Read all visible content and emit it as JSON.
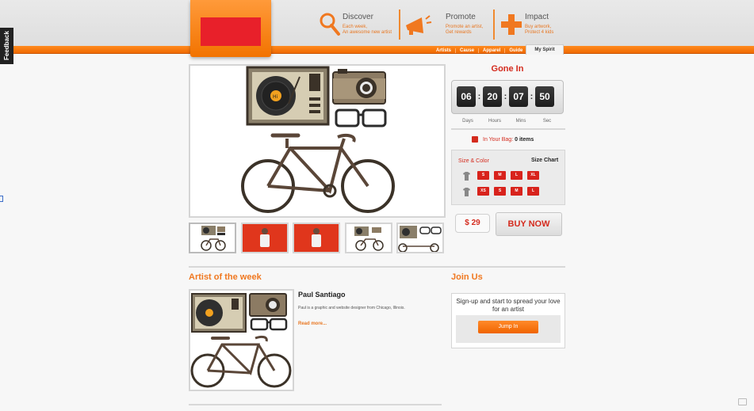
{
  "feedback_label": "Feedback",
  "header": {
    "features": [
      {
        "title": "Discover",
        "line1": "Each week,",
        "line2": "An awesome new artist",
        "icon": "magnifier-icon"
      },
      {
        "title": "Promote",
        "line1": "Promote an artist,",
        "line2": "Get rewards",
        "icon": "megaphone-icon"
      },
      {
        "title": "Impact",
        "line1": "Buy artwork,",
        "line2": "Protect 4 kids",
        "icon": "plus-icon"
      }
    ],
    "nav": [
      "Artists",
      "Cause",
      "Apparel",
      "Guide"
    ],
    "active_tab": "My Spirit"
  },
  "countdown": {
    "title": "Gone In",
    "values": [
      "06",
      "20",
      "07",
      "50"
    ],
    "labels": [
      "Days",
      "Hours",
      "Mins",
      "Sec"
    ]
  },
  "bag": {
    "label": "In Your Bag:",
    "count": "0 items"
  },
  "sizes": {
    "title": "Size & Color",
    "chart_link": "Size Chart",
    "row1": [
      "S",
      "M",
      "L",
      "XL"
    ],
    "row2": [
      "XS",
      "S",
      "M",
      "L"
    ]
  },
  "price": "$ 29",
  "buy_label": "BUY NOW",
  "artist_section": {
    "title": "Artist of the week",
    "name": "Paul Santiago",
    "desc": "Paul is a graphic and website designer from Chicago, Illinois.",
    "read_more": "Read more..."
  },
  "join": {
    "title": "Join Us",
    "text": "Sign-up and start to spread your love for an artist",
    "button": "Jump In"
  },
  "colors": {
    "accent": "#f07820",
    "red": "#d42b1e"
  }
}
